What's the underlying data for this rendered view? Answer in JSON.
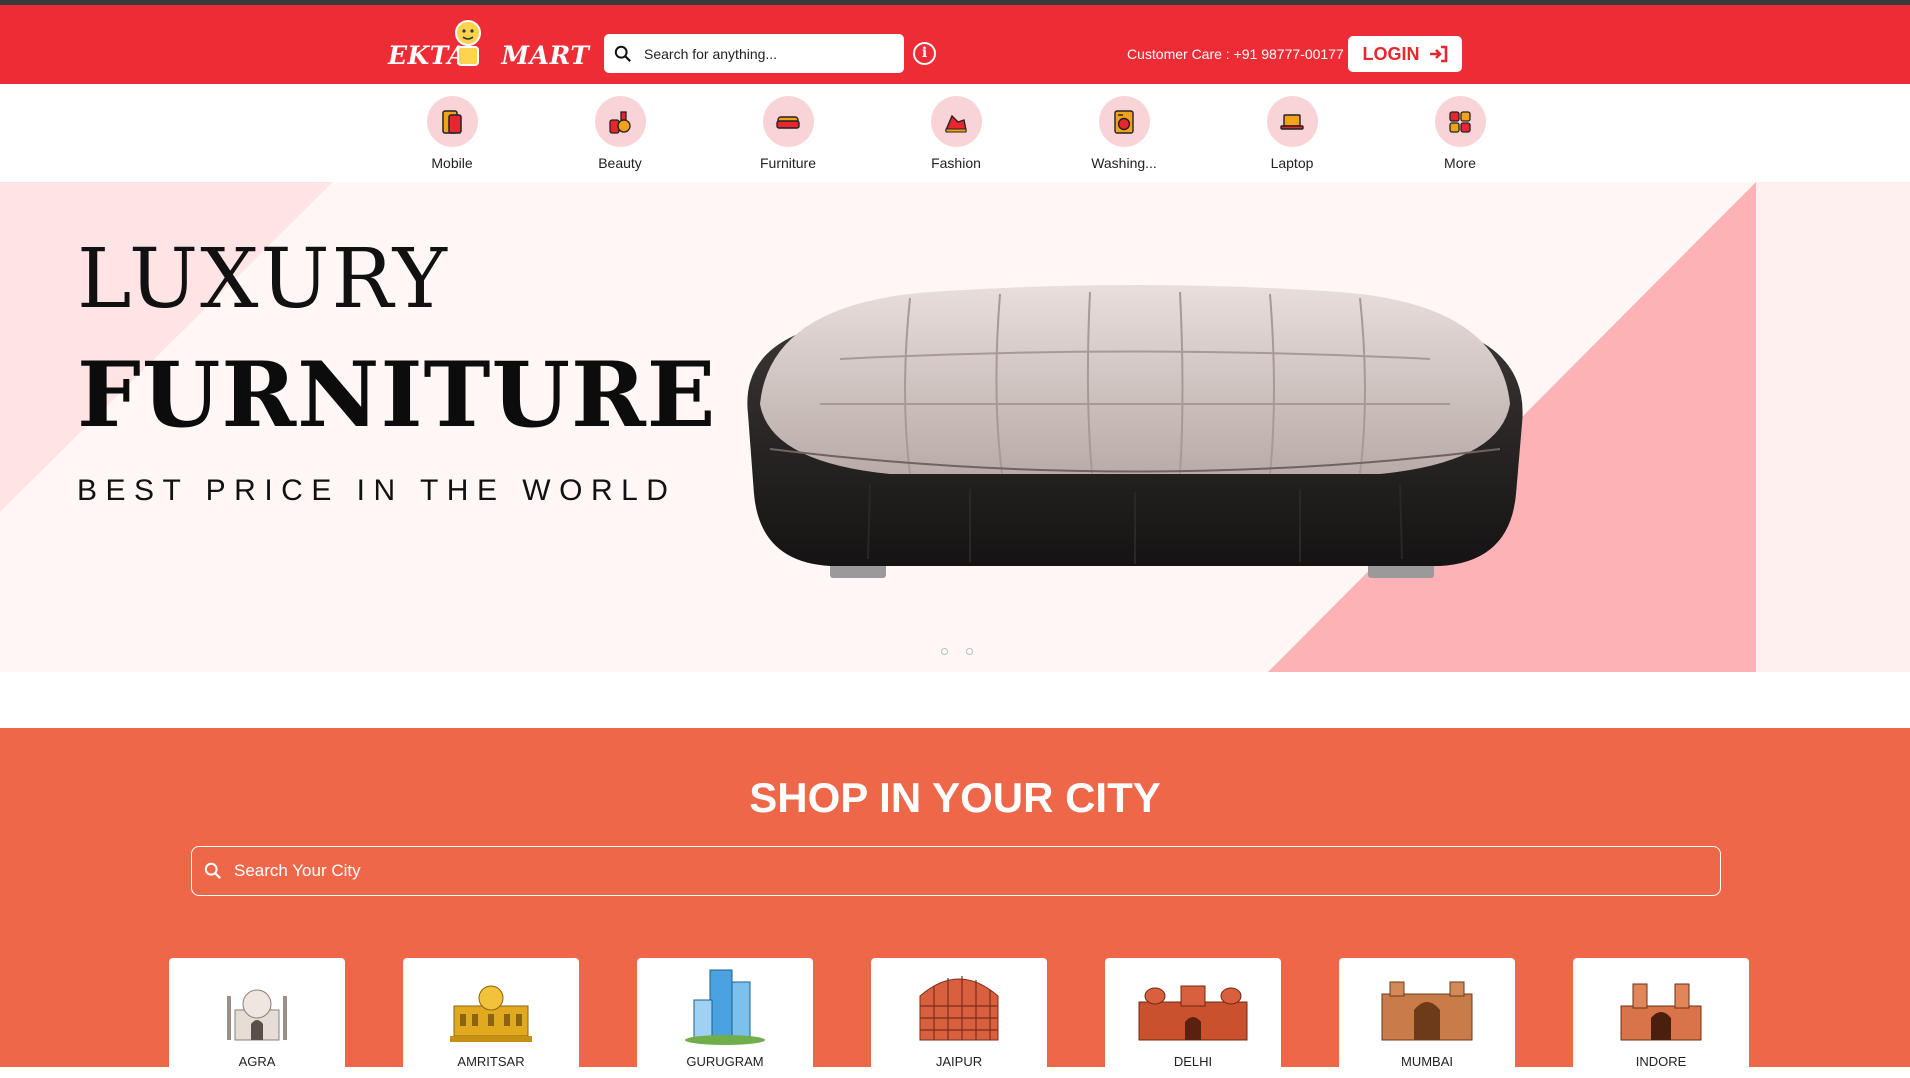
{
  "header": {
    "logo_text_left": "EKTA",
    "logo_text_right": "MART",
    "search_placeholder": "Search for anything...",
    "customer_care": "Customer Care : +91 98777-00177",
    "login_label": "LOGIN"
  },
  "categories": [
    {
      "label": "Mobile",
      "icon": "mobile-icon"
    },
    {
      "label": "Beauty",
      "icon": "beauty-icon"
    },
    {
      "label": "Furniture",
      "icon": "sofa-icon"
    },
    {
      "label": "Fashion",
      "icon": "fashion-icon"
    },
    {
      "label": "Washing...",
      "icon": "washing-machine-icon"
    },
    {
      "label": "Laptop",
      "icon": "laptop-icon"
    },
    {
      "label": "More",
      "icon": "grid-icon"
    }
  ],
  "banner": {
    "line1": "LUXURY",
    "line2": "FURNITURE",
    "line3": "BEST PRICE IN THE WORLD",
    "slides": 2,
    "active_slide": 1
  },
  "city_section": {
    "title": "SHOP IN YOUR CITY",
    "search_placeholder": "Search Your City",
    "cities": [
      "AGRA",
      "AMRITSAR",
      "GURUGRAM",
      "JAIPUR",
      "DELHI",
      "MUMBAI",
      "INDORE"
    ]
  },
  "colors": {
    "header_red": "#ee2c35",
    "city_orange": "#ee6749",
    "banner_pink": "#fdb3b6"
  }
}
